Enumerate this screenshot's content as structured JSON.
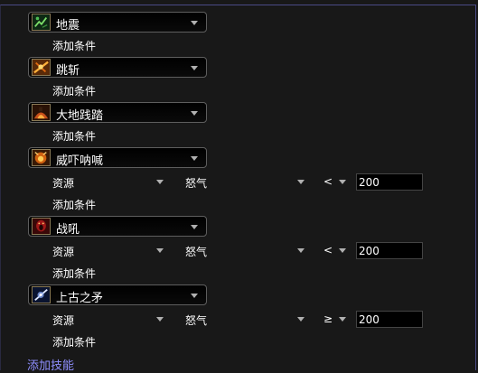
{
  "skills": [
    {
      "name": "地震",
      "icon": "earthquake-icon"
    },
    {
      "name": "跳斩",
      "icon": "leap-slash-icon"
    },
    {
      "name": "大地践踏",
      "icon": "war-stomp-icon"
    },
    {
      "name": "威吓呐喊",
      "icon": "intimidating-shout-icon"
    },
    {
      "name": "战吼",
      "icon": "battle-shout-icon"
    },
    {
      "name": "上古之矛",
      "icon": "ancient-spear-icon"
    }
  ],
  "add_condition_label": "添加条件",
  "conditions": [
    {
      "type": "资源",
      "resource": "怒气",
      "operator": "<",
      "value": "200"
    },
    {
      "type": "资源",
      "resource": "怒气",
      "operator": "<",
      "value": "200"
    },
    {
      "type": "资源",
      "resource": "怒气",
      "operator": "≥",
      "value": "200"
    }
  ],
  "add_skill_label": "添加技能",
  "colors": {
    "background": "#181818",
    "border": "#4b4a86",
    "link": "#8f8fff"
  }
}
